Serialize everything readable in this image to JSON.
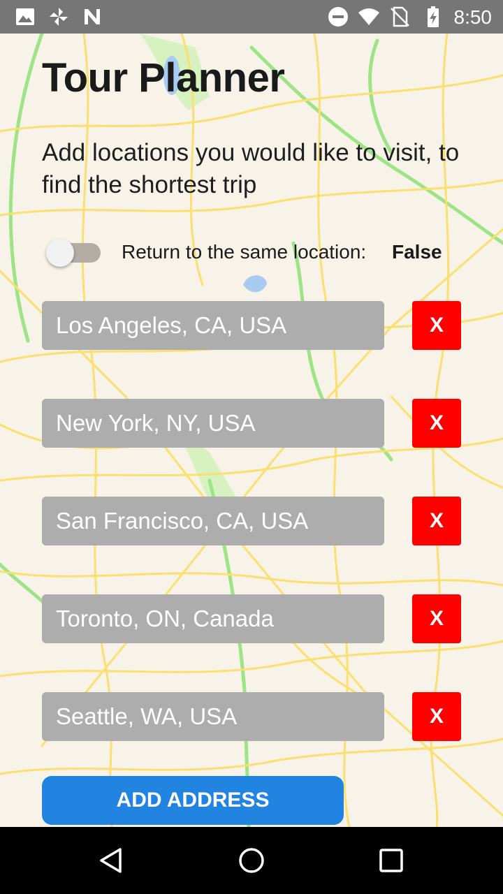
{
  "status_bar": {
    "time": "8:50",
    "left_icons": [
      "image-icon",
      "pinwheel-icon",
      "n-logo-icon"
    ],
    "right_icons": [
      "do-not-disturb-icon",
      "wifi-icon",
      "no-sim-icon",
      "battery-charging-icon"
    ]
  },
  "header": {
    "title": "Tour Planner",
    "subtitle": "Add locations you would like to visit, to find the shortest trip"
  },
  "toggle": {
    "label": "Return to the same location:",
    "value": "False",
    "on": false
  },
  "locations": [
    {
      "value": "Los Angeles, CA, USA",
      "delete_label": "X"
    },
    {
      "value": "New York, NY, USA",
      "delete_label": "X"
    },
    {
      "value": "San Francisco, CA, USA",
      "delete_label": "X"
    },
    {
      "value": "Toronto, ON, Canada",
      "delete_label": "X"
    },
    {
      "value": "Seattle, WA, USA",
      "delete_label": "X"
    }
  ],
  "add_button_label": "ADD ADDRESS",
  "colors": {
    "status_bar": "#767676",
    "background": "#f7f3e8",
    "input": "#adadad",
    "delete": "#fe0000",
    "accent": "#2284e1",
    "road": "#fbe06f",
    "park": "#d7f2c0",
    "water": "#a8cbf0"
  },
  "nav_bar": {
    "icons": [
      "back-icon",
      "home-icon",
      "recents-icon"
    ]
  }
}
